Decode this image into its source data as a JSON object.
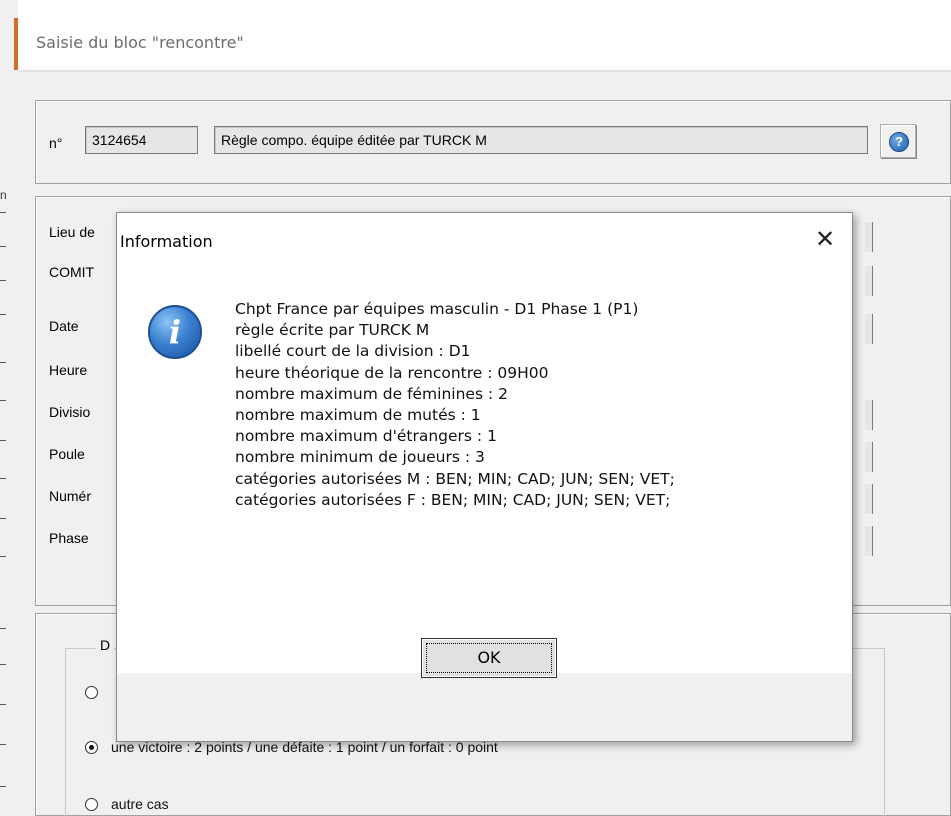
{
  "window": {
    "title": "Saisie du bloc \"rencontre\""
  },
  "header_row": {
    "number_label": "n°",
    "number_value": "3124654",
    "rule_text": "Règle compo. équipe éditée par TURCK M",
    "help_icon": "question-circle-icon"
  },
  "form_rows": [
    {
      "label": "Lieu de"
    },
    {
      "label": "COMIT"
    },
    {
      "label": "Date"
    },
    {
      "label": "Heure"
    },
    {
      "label": "Divisio"
    },
    {
      "label": "Poule"
    },
    {
      "label": "Numér"
    },
    {
      "label": "Phase"
    }
  ],
  "points_group": {
    "title": "D",
    "options": [
      {
        "label": "",
        "checked": false
      },
      {
        "label": "une victoire : 2 points / une défaite : 1 point / un forfait : 0 point",
        "checked": true
      },
      {
        "label": "autre cas",
        "checked": false
      }
    ]
  },
  "dialog": {
    "title": "Information",
    "close_glyph": "✕",
    "icon": "info-icon",
    "lines": [
      "Chpt France par équipes masculin - D1 Phase 1 (P1)",
      "règle écrite par TURCK M",
      "libellé court de la division : D1",
      "heure théorique de la rencontre : 09H00",
      "nombre maximum de féminines : 2",
      "nombre maximum de mutés : 1",
      "nombre maximum d'étrangers : 1",
      "nombre minimum de joueurs : 3",
      "catégories autorisées M : BEN; MIN; CAD; JUN; SEN; VET;",
      "catégories autorisées F : BEN; MIN; CAD; JUN; SEN; VET;"
    ],
    "ok_label": "OK"
  },
  "left_strip": {
    "fragment": "n"
  },
  "colors": {
    "accent_orange": "#d86b2c",
    "window_bg": "#f0f0f0",
    "field_gray": "#e6e6e6"
  }
}
